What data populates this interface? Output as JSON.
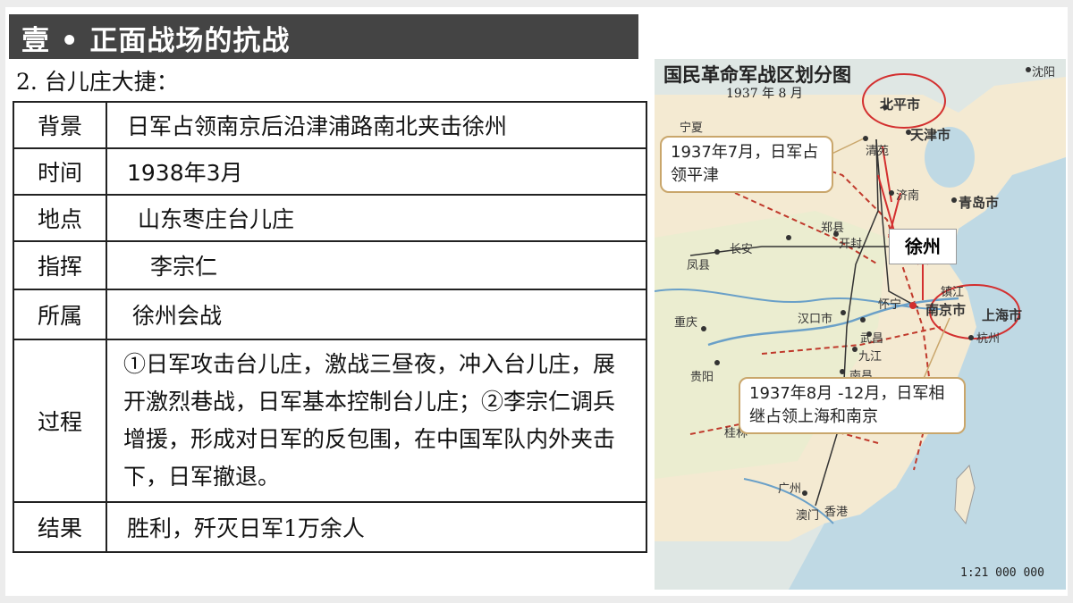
{
  "header": {
    "title": "壹 • 正面战场的抗战"
  },
  "subtitle": "2. 台儿庄大捷：",
  "rows": [
    {
      "label": "背景",
      "value": "日军占领南京后沿津浦路南北夹击徐州"
    },
    {
      "label": "时间",
      "value": "1938年3月"
    },
    {
      "label": "地点",
      "value": "山东枣庄台儿庄"
    },
    {
      "label": "指挥",
      "value": "李宗仁"
    },
    {
      "label": "所属",
      "value": "徐州会战"
    },
    {
      "label": "过程",
      "value": "①日军攻击台儿庄，激战三昼夜，冲入台儿庄，展开激烈巷战，日军基本控制台儿庄；②李宗仁调兵增援，形成对日军的反包围，在中国军队内外夹击下，日军撤退。"
    },
    {
      "label": "结果",
      "value": "胜利，歼灭日军1万余人"
    }
  ],
  "map": {
    "title": "国民革命军战区划分图",
    "subtitle": "1937 年 8 月",
    "scale": "1:21 000 000",
    "callout_north": "1937年7月，日军占领平津",
    "callout_south": "1937年8月 -12月，日军相继占领上海和南京",
    "xuzhou_label": "徐州",
    "cities": {
      "beiping": "北平市",
      "tianjin": "天津市",
      "shenyang": "沈阳",
      "qingdao": "青岛市",
      "jinan": "济南",
      "ningxia": "宁夏",
      "zhengzhou": "郑县",
      "kaifeng": "开封",
      "changan": "长安",
      "nanjing": "南京市",
      "shanghai": "上海市",
      "hankou": "汉口市",
      "huaining": "怀宁",
      "wuchang": "武昌",
      "jiujiang": "九江",
      "nanchang": "南昌",
      "hangzhou": "杭州",
      "chongqing": "重庆",
      "guiyang": "贵阳",
      "guilin": "桂林",
      "guangzhou": "广州",
      "aomen": "澳门",
      "xianggang": "香港",
      "fengxian": "凤县",
      "qingyuan": "清苑",
      "zhenjiang": "镇江"
    }
  }
}
